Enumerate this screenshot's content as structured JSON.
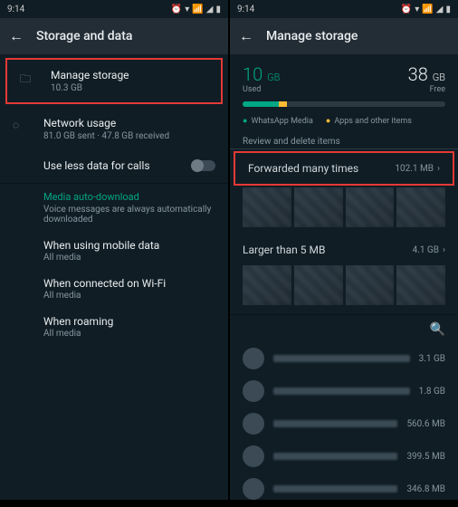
{
  "left": {
    "statusbar": {
      "time": "9:14"
    },
    "appbar": {
      "title": "Storage and data"
    },
    "manage_storage": {
      "label": "Manage storage",
      "sub": "10.3 GB"
    },
    "network_usage": {
      "label": "Network usage",
      "sub": "81.0 GB sent · 47.8 GB received"
    },
    "less_data": {
      "label": "Use less data for calls"
    },
    "auto_download": {
      "title": "Media auto-download",
      "sub": "Voice messages are always automatically downloaded"
    },
    "mobile": {
      "label": "When using mobile data",
      "sub": "All media"
    },
    "wifi": {
      "label": "When connected on Wi-Fi",
      "sub": "All media"
    },
    "roaming": {
      "label": "When roaming",
      "sub": "All media"
    }
  },
  "right": {
    "statusbar": {
      "time": "9:14"
    },
    "appbar": {
      "title": "Manage storage"
    },
    "used": {
      "num": "10",
      "unit": "GB",
      "label": "Used"
    },
    "free": {
      "num": "38",
      "unit": "GB",
      "label": "Free"
    },
    "legend": {
      "media": "WhatsApp Media",
      "other": "Apps and other items"
    },
    "review": "Review and delete items",
    "forwarded": {
      "label": "Forwarded many times",
      "size": "102.1 MB"
    },
    "larger": {
      "label": "Larger than 5 MB",
      "size": "4.1 GB"
    },
    "chats": [
      {
        "size": "3.1 GB"
      },
      {
        "size": "1.8 GB"
      },
      {
        "size": "560.6 MB"
      },
      {
        "size": "399.5 MB"
      },
      {
        "size": "346.8 MB"
      }
    ]
  }
}
